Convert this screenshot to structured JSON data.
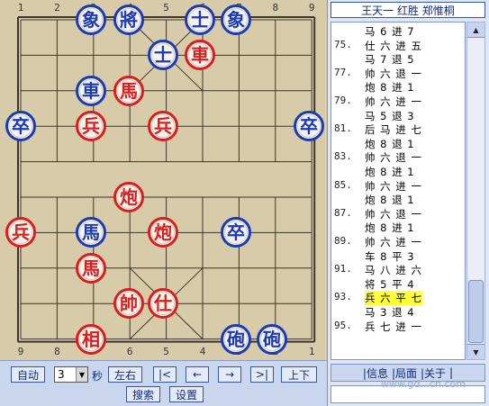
{
  "board": {
    "file_numbers_top": [
      "1",
      "2",
      "3",
      "4",
      "5",
      "6",
      "7",
      "8",
      "9"
    ],
    "file_numbers_bottom": [
      "9",
      "8",
      "7",
      "6",
      "5",
      "4",
      "3",
      "2",
      "1"
    ],
    "pieces": [
      {
        "char": "象",
        "side": "blue",
        "file": 3,
        "rank": 0
      },
      {
        "char": "將",
        "side": "blue",
        "file": 4,
        "rank": 0
      },
      {
        "char": "士",
        "side": "blue",
        "file": 6,
        "rank": 0
      },
      {
        "char": "象",
        "side": "blue",
        "file": 7,
        "rank": 0
      },
      {
        "char": "士",
        "side": "blue",
        "file": 5,
        "rank": 1
      },
      {
        "char": "車",
        "side": "red",
        "file": 6,
        "rank": 1
      },
      {
        "char": "車",
        "side": "blue",
        "file": 3,
        "rank": 2
      },
      {
        "char": "馬",
        "side": "red",
        "file": 4,
        "rank": 2
      },
      {
        "char": "卒",
        "side": "blue",
        "file": 0,
        "rank": 3
      },
      {
        "char": "兵",
        "side": "red",
        "file": 3,
        "rank": 3
      },
      {
        "char": "兵",
        "side": "red",
        "file": 5,
        "rank": 3
      },
      {
        "char": "卒",
        "side": "blue",
        "file": 9,
        "rank": 3
      },
      {
        "char": "炮",
        "side": "red",
        "file": 4,
        "rank": 5
      },
      {
        "char": "兵",
        "side": "red",
        "file": 0,
        "rank": 6
      },
      {
        "char": "馬",
        "side": "blue",
        "file": 3,
        "rank": 6
      },
      {
        "char": "炮",
        "side": "red",
        "file": 5,
        "rank": 6
      },
      {
        "char": "卒",
        "side": "blue",
        "file": 7,
        "rank": 6
      },
      {
        "char": "馬",
        "side": "red",
        "file": 3,
        "rank": 7
      },
      {
        "char": "帥",
        "side": "red",
        "file": 4,
        "rank": 8
      },
      {
        "char": "仕",
        "side": "red",
        "file": 5,
        "rank": 8
      },
      {
        "char": "相",
        "side": "red",
        "file": 3,
        "rank": 9
      },
      {
        "char": "砲",
        "side": "blue",
        "file": 7,
        "rank": 9
      },
      {
        "char": "砲",
        "side": "blue",
        "file": 8,
        "rank": 9
      }
    ]
  },
  "controls": {
    "auto": "自动",
    "interval_value": "3",
    "seconds": "秒",
    "flip": "左右",
    "first": "|<",
    "prev": "←",
    "next": "→",
    "last": ">|",
    "updown": "上下",
    "search": "搜索",
    "settings": "设置"
  },
  "panel": {
    "title": "王天一 红胜 郑惟桐",
    "moves": [
      {
        "num": "",
        "text": "马 6 进 7"
      },
      {
        "num": "75.",
        "text": "仕 六 进 五"
      },
      {
        "num": "",
        "text": "马 7 退 5"
      },
      {
        "num": "77.",
        "text": "帅 六 退 一"
      },
      {
        "num": "",
        "text": "炮 8 进 1"
      },
      {
        "num": "79.",
        "text": "帅 六 进 一"
      },
      {
        "num": "",
        "text": "马 5 退 3"
      },
      {
        "num": "81.",
        "text": "后 马 进 七"
      },
      {
        "num": "",
        "text": "炮 8 退 1"
      },
      {
        "num": "83.",
        "text": "帅 六 退 一"
      },
      {
        "num": "",
        "text": "炮 8 进 1"
      },
      {
        "num": "85.",
        "text": "帅 六 进 一"
      },
      {
        "num": "",
        "text": "炮 8 退 1"
      },
      {
        "num": "87.",
        "text": "帅 六 退 一"
      },
      {
        "num": "",
        "text": "炮 8 进 1"
      },
      {
        "num": "89.",
        "text": "帅 六 进 一"
      },
      {
        "num": "",
        "text": "车 8 平 3"
      },
      {
        "num": "91.",
        "text": "马 八 进 六"
      },
      {
        "num": "",
        "text": "将 5 平 4"
      },
      {
        "num": "93.",
        "text": "兵 六 平 七",
        "highlight": true
      },
      {
        "num": "",
        "text": "马 3 退 4"
      },
      {
        "num": "95.",
        "text": "兵 七 进 一"
      }
    ],
    "links": [
      "|信息",
      "|局面",
      "|关于",
      "|"
    ],
    "watermark": "www.gd...cn.com"
  },
  "colors": {
    "red": "#d81e1e",
    "blue": "#1b3bb5",
    "board": "#d8cbaa",
    "highlight": "#ffff3a"
  }
}
